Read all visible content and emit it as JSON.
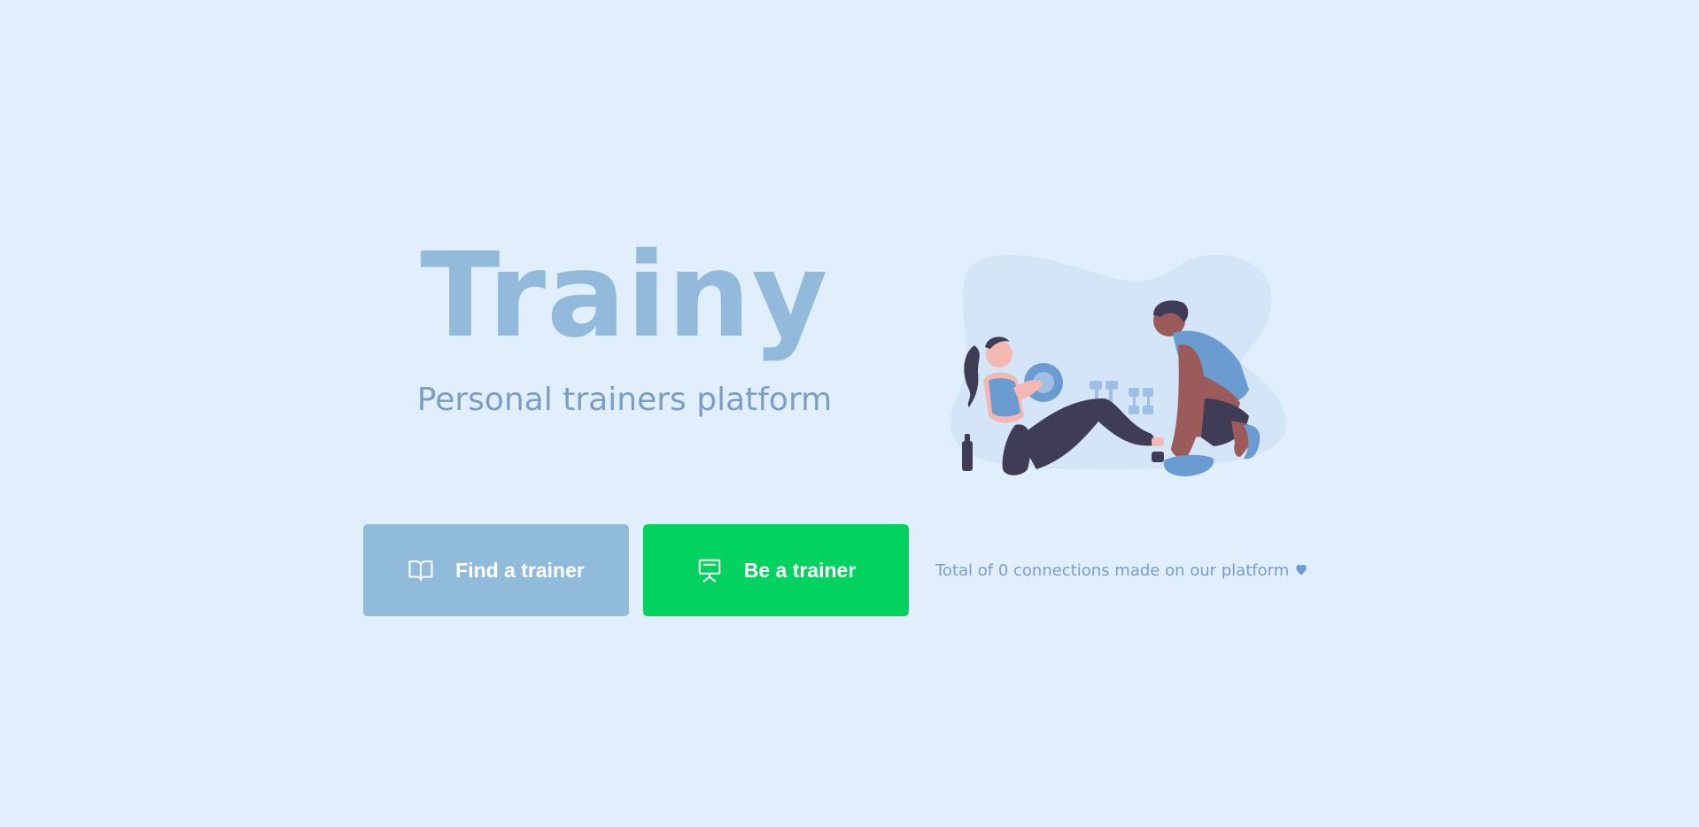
{
  "brand": {
    "title": "Trainy",
    "subtitle": "Personal trainers platform"
  },
  "actions": {
    "find_trainer": {
      "label": "Find a trainer",
      "icon": "book-open-icon",
      "color": "#91bbdb"
    },
    "be_trainer": {
      "label": "Be a trainer",
      "icon": "presentation-board-icon",
      "color": "#04d25f"
    }
  },
  "stats": {
    "connections_text": "Total of 0 connections made on our platform",
    "heart_icon": "heart-icon"
  },
  "illustration": {
    "name": "workout-illustration"
  },
  "colors": {
    "background": "#e1effd",
    "title": "#92bbdb",
    "subtitle": "#7c9ec4",
    "accent_green": "#04d25f"
  }
}
